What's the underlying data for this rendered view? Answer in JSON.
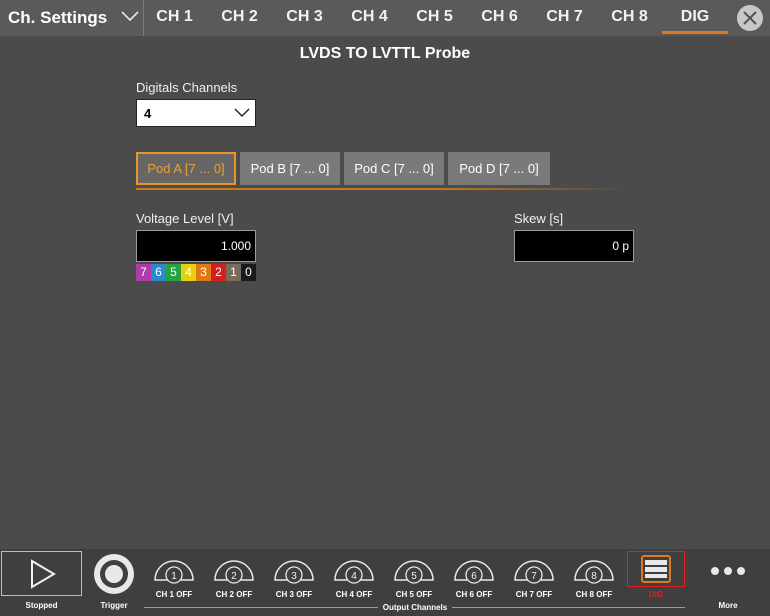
{
  "header": {
    "settings_label": "Ch. Settings",
    "tabs": [
      "CH 1",
      "CH 2",
      "CH 3",
      "CH 4",
      "CH 5",
      "CH 6",
      "CH 7",
      "CH 8",
      "DIG"
    ],
    "active_tab": "DIG"
  },
  "main": {
    "probe_title": "LVDS TO LVTTL Probe",
    "digital_channels_label": "Digitals Channels",
    "digital_channels_value": "4",
    "pods": [
      "Pod  A  [7 ... 0]",
      "Pod  B  [7 ... 0]",
      "Pod  C  [7 ... 0]",
      "Pod  D  [7 ... 0]"
    ],
    "voltage_label": "Voltage Level [V]",
    "voltage_value": "1.000",
    "skew_label": "Skew [s]",
    "skew_value": "0 p",
    "bits": [
      {
        "label": "7",
        "color": "#b03aa8"
      },
      {
        "label": "6",
        "color": "#2a8ad0"
      },
      {
        "label": "5",
        "color": "#2aa040"
      },
      {
        "label": "4",
        "color": "#e8d010"
      },
      {
        "label": "3",
        "color": "#e07818"
      },
      {
        "label": "2",
        "color": "#d02020"
      },
      {
        "label": "1",
        "color": "#7a6a5a"
      },
      {
        "label": "0",
        "color": "#1a1a1a"
      }
    ]
  },
  "bottom": {
    "run_label": "Stopped",
    "trigger_label": "Trigger",
    "channels": [
      {
        "num": "1",
        "label": "CH 1 OFF"
      },
      {
        "num": "2",
        "label": "CH 2 OFF"
      },
      {
        "num": "3",
        "label": "CH 3 OFF"
      },
      {
        "num": "4",
        "label": "CH 4 OFF"
      },
      {
        "num": "5",
        "label": "CH 5 OFF"
      },
      {
        "num": "6",
        "label": "CH 6 OFF"
      },
      {
        "num": "7",
        "label": "CH 7 OFF"
      },
      {
        "num": "8",
        "label": "CH 8 OFF"
      }
    ],
    "dig_label": "DIG",
    "output_channels_label": "Output Channels",
    "more_label": "More"
  },
  "colors": {
    "accent": "#e8962a",
    "dig_border": "#e02020"
  }
}
